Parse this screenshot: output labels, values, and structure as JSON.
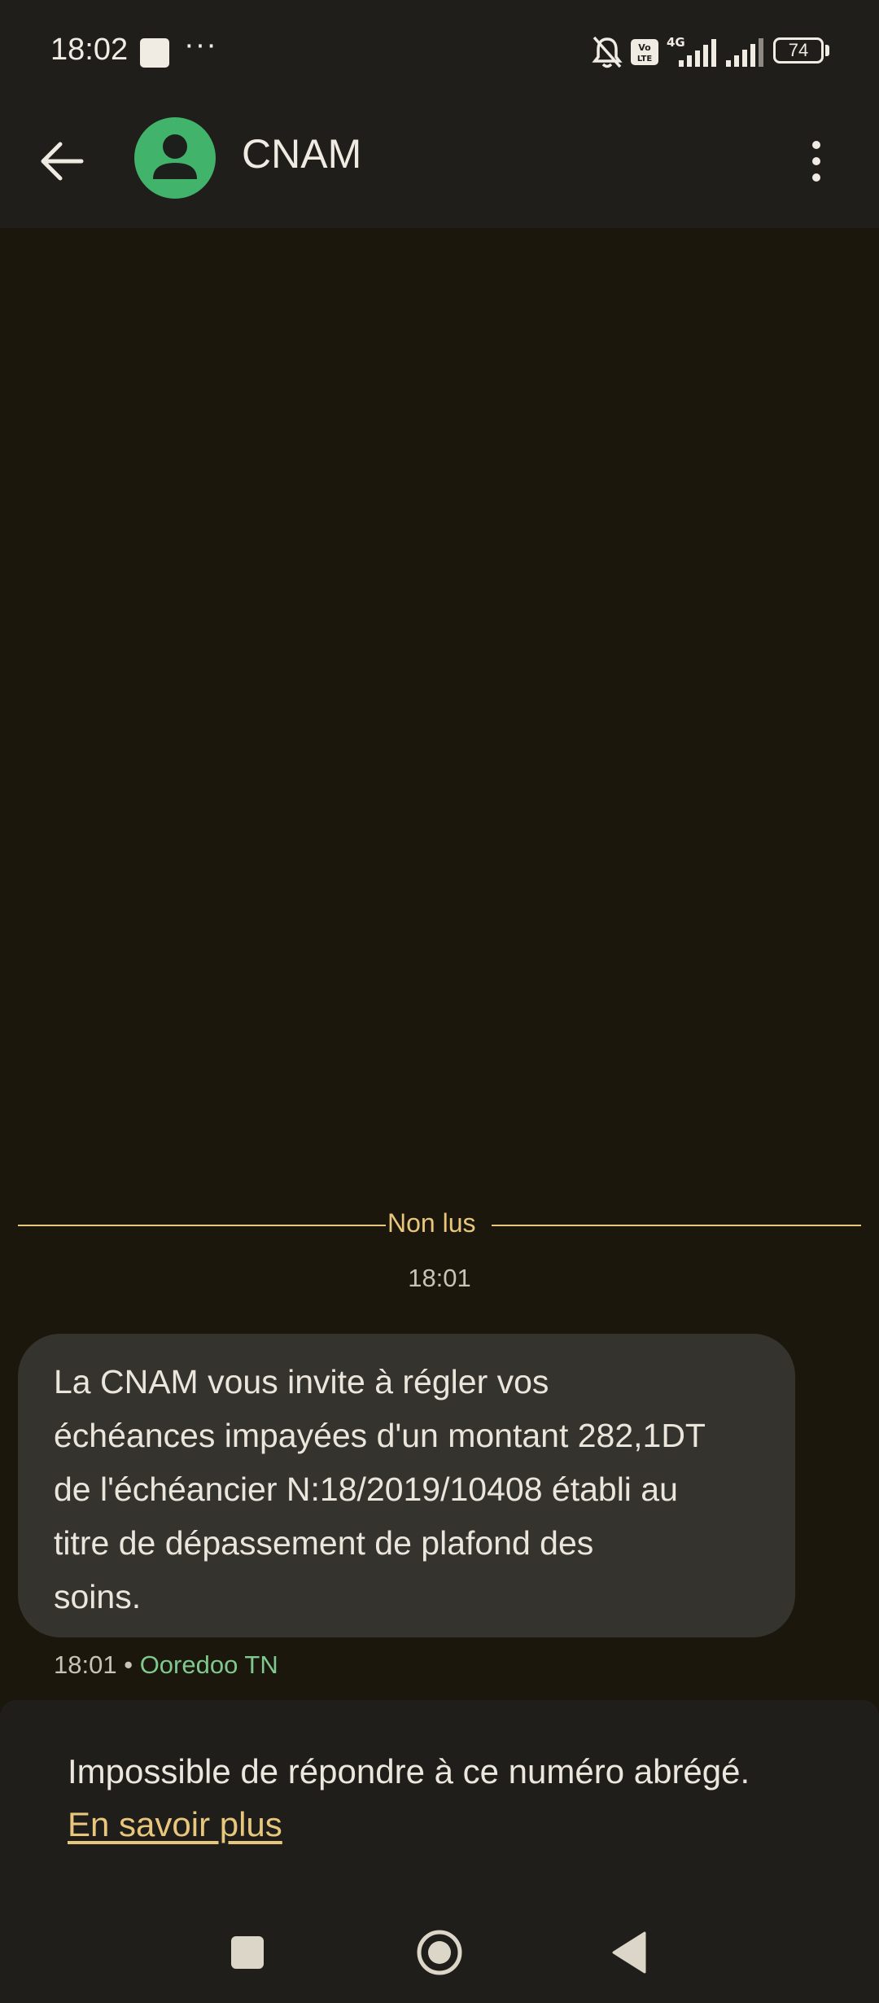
{
  "status_bar": {
    "time": "18:02",
    "dots": "···",
    "network_type": "4G",
    "volte": "Vo LTE",
    "battery": "74",
    "icons": [
      "notification-square-icon",
      "silent-bell-icon",
      "volte-icon",
      "signal-4g-icon",
      "signal-icon",
      "battery-icon"
    ]
  },
  "app_bar": {
    "contact_name": "CNAM",
    "icons": [
      "back-arrow-icon",
      "person-icon",
      "more-vert-icon"
    ],
    "avatar_color": "#41b36a"
  },
  "conversation": {
    "unread_label": "Non lus",
    "time_header": "18:01",
    "messages": [
      {
        "lines": [
          "La CNAM vous invite à régler vos",
          "échéances impayées d'un montant 282,1DT",
          "de l'échéancier N:18/2019/10408 établi au",
          "titre de dépassement  de plafond des",
          "soins."
        ],
        "time": "18:01",
        "separator": "•",
        "carrier": "Ooredoo TN"
      }
    ]
  },
  "reply_notice": {
    "text": "Impossible de répondre à ce numéro abrégé.",
    "link": "En savoir plus"
  },
  "nav_bar": {
    "icons": [
      "recents-square-icon",
      "home-circle-icon",
      "back-triangle-icon"
    ]
  },
  "colors": {
    "background": "#1b170c",
    "surface": "#201e1b",
    "bubble": "#35332e",
    "accent": "#e8c77c",
    "carrier_green": "#7fc88e"
  }
}
